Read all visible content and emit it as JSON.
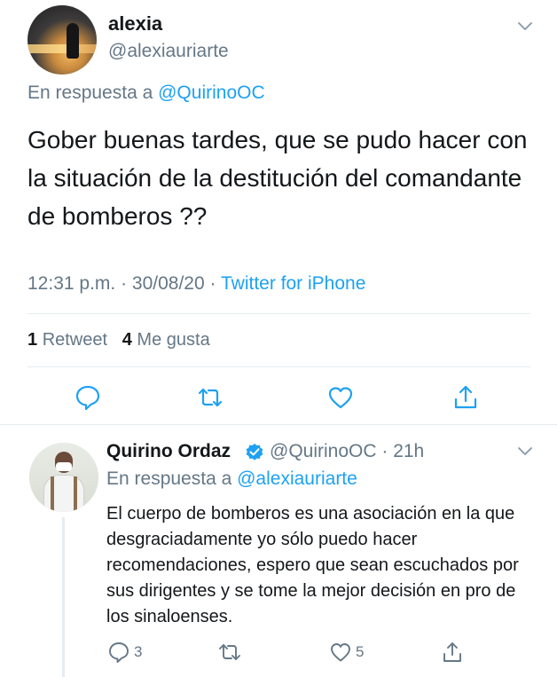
{
  "main_tweet": {
    "author": {
      "name": "alexia",
      "handle": "@alexiauriarte"
    },
    "reply_prefix": "En respuesta a",
    "reply_to": "@QuirinoOC",
    "text": "Gober buenas tardes, que se pudo hacer con la situación de la destitución del comandante de bomberos ??",
    "time": "12:31 p.m.",
    "date": "30/08/20",
    "source": "Twitter for iPhone",
    "separator": "·",
    "stats": {
      "retweets_count": "1",
      "retweets_label": "Retweet",
      "likes_count": "4",
      "likes_label": "Me gusta"
    },
    "actions": [
      "reply-icon",
      "retweet-icon",
      "like-icon",
      "share-icon"
    ]
  },
  "reply_tweet": {
    "author": {
      "name": "Quirino Ordaz",
      "handle": "@QuirinoOC",
      "time_ago": "21h",
      "separator": "·"
    },
    "reply_prefix": "En respuesta a",
    "reply_to": "@alexiauriarte",
    "text": "El cuerpo de bomberos es una asociación en la que desgraciadamente yo sólo puedo hacer recomendaciones, espero que sean escuchados por sus dirigentes y se tome la mejor decisión en pro de los sinaloenses.",
    "counts": {
      "replies": "3",
      "likes": "5"
    }
  },
  "colors": {
    "accent": "#1da1f2",
    "secondary_text": "#657786",
    "divider": "#e6ecf0"
  }
}
